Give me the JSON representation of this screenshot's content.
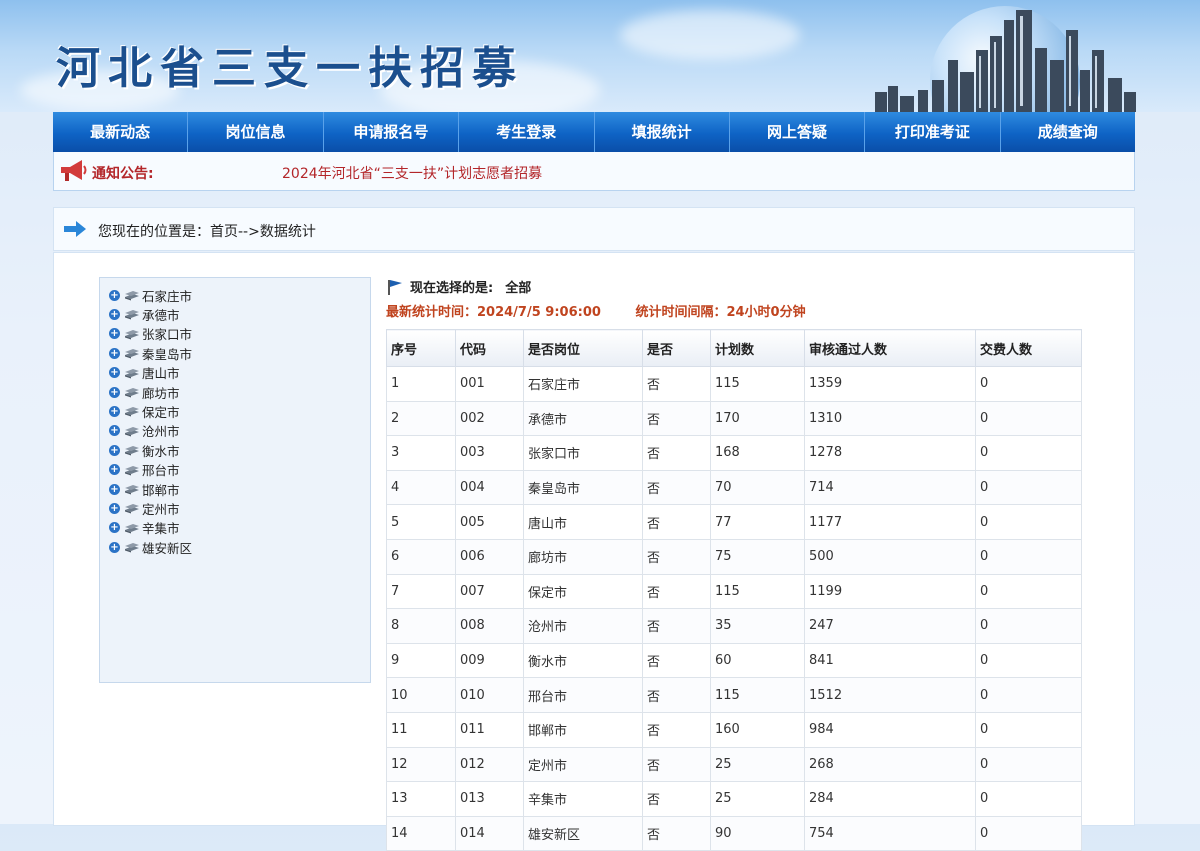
{
  "header": {
    "title": "河北省三支一扶招募"
  },
  "nav": {
    "items": [
      "最新动态",
      "岗位信息",
      "申请报名号",
      "考生登录",
      "填报统计",
      "网上答疑",
      "打印准考证",
      "成绩查询"
    ]
  },
  "notice": {
    "label": "通知公告:",
    "text": "2024年河北省“三支一扶”计划志愿者招募"
  },
  "breadcrumb": {
    "text": "您现在的位置是：首页-->数据统计"
  },
  "tree": {
    "items": [
      "石家庄市",
      "承德市",
      "张家口市",
      "秦皇岛市",
      "唐山市",
      "廊坊市",
      "保定市",
      "沧州市",
      "衡水市",
      "邢台市",
      "邯郸市",
      "定州市",
      "辛集市",
      "雄安新区"
    ]
  },
  "selection": {
    "label": "现在选择的是:",
    "value": "全部"
  },
  "stats": {
    "time_label": "最新统计时间：2024/7/5 9:06:00",
    "interval_label": "统计时间间隔：24小时0分钟"
  },
  "table": {
    "headers": [
      "序号",
      "代码",
      "是否岗位",
      "是否",
      "计划数",
      "审核通过人数",
      "交费人数"
    ],
    "rows": [
      [
        "1",
        "001",
        "石家庄市",
        "否",
        "115",
        "1359",
        "0"
      ],
      [
        "2",
        "002",
        "承德市",
        "否",
        "170",
        "1310",
        "0"
      ],
      [
        "3",
        "003",
        "张家口市",
        "否",
        "168",
        "1278",
        "0"
      ],
      [
        "4",
        "004",
        "秦皇岛市",
        "否",
        "70",
        "714",
        "0"
      ],
      [
        "5",
        "005",
        "唐山市",
        "否",
        "77",
        "1177",
        "0"
      ],
      [
        "6",
        "006",
        "廊坊市",
        "否",
        "75",
        "500",
        "0"
      ],
      [
        "7",
        "007",
        "保定市",
        "否",
        "115",
        "1199",
        "0"
      ],
      [
        "8",
        "008",
        "沧州市",
        "否",
        "35",
        "247",
        "0"
      ],
      [
        "9",
        "009",
        "衡水市",
        "否",
        "60",
        "841",
        "0"
      ],
      [
        "10",
        "010",
        "邢台市",
        "否",
        "115",
        "1512",
        "0"
      ],
      [
        "11",
        "011",
        "邯郸市",
        "否",
        "160",
        "984",
        "0"
      ],
      [
        "12",
        "012",
        "定州市",
        "否",
        "25",
        "268",
        "0"
      ],
      [
        "13",
        "013",
        "辛集市",
        "否",
        "25",
        "284",
        "0"
      ],
      [
        "14",
        "014",
        "雄安新区",
        "否",
        "90",
        "754",
        "0"
      ]
    ]
  },
  "colors": {
    "nav_bg": "#0e63c5",
    "notice_red": "#b3262a",
    "stat_orange": "#c0441f",
    "title_blue": "#1b4f8e"
  }
}
